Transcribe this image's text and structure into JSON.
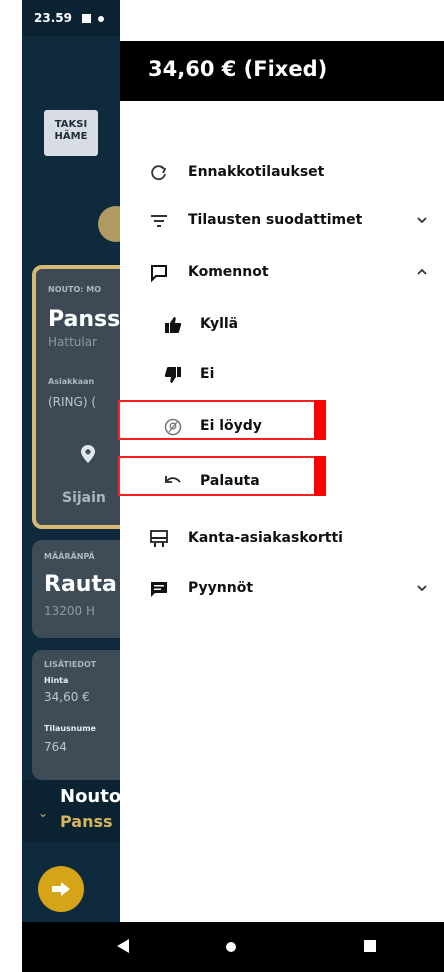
{
  "status_bar": {
    "time": "23.59"
  },
  "background_app": {
    "logo_line1": "TAKSI",
    "logo_line2": "HÄME",
    "pickup_label": "NOUTO: MO",
    "pickup_title": "Panss",
    "pickup_sub": "Hattular",
    "customer_label": "Asiakkaan",
    "customer_value": "(RING) (",
    "location_label": "Sijain",
    "destination_label": "MÄÄRÄNPÄ",
    "destination_title": "Rauta",
    "destination_sub": "13200 H",
    "extra_label": "LISÄTIEDOT",
    "price_label": "Hinta",
    "price_value": "34,60 €",
    "order_label": "Tilausnume",
    "order_value": "764",
    "bottom_title": "Nouto",
    "bottom_sub": "Panss"
  },
  "drawer": {
    "header_title": "34,60 € (Fixed)",
    "items": [
      {
        "label": "Ennakkotilaukset",
        "icon": "refresh-icon"
      },
      {
        "label": "Tilausten suodattimet",
        "icon": "filter-icon",
        "chevron": "down"
      },
      {
        "label": "Komennot",
        "icon": "comment-icon",
        "chevron": "up"
      },
      {
        "label": "Kyllä",
        "icon": "thumbs-up-icon"
      },
      {
        "label": "Ei",
        "icon": "thumbs-down-icon"
      },
      {
        "label": "Ei löydy",
        "icon": "not-found-icon"
      },
      {
        "label": "Palauta",
        "icon": "undo-icon"
      },
      {
        "label": "Kanta-asiakaskortti",
        "icon": "card-icon"
      },
      {
        "label": "Pyynnöt",
        "icon": "message-icon",
        "chevron": "down"
      }
    ]
  },
  "colors": {
    "header_bg": "#000000",
    "highlight": "#ff2020",
    "accent_gold": "#d5b974"
  }
}
